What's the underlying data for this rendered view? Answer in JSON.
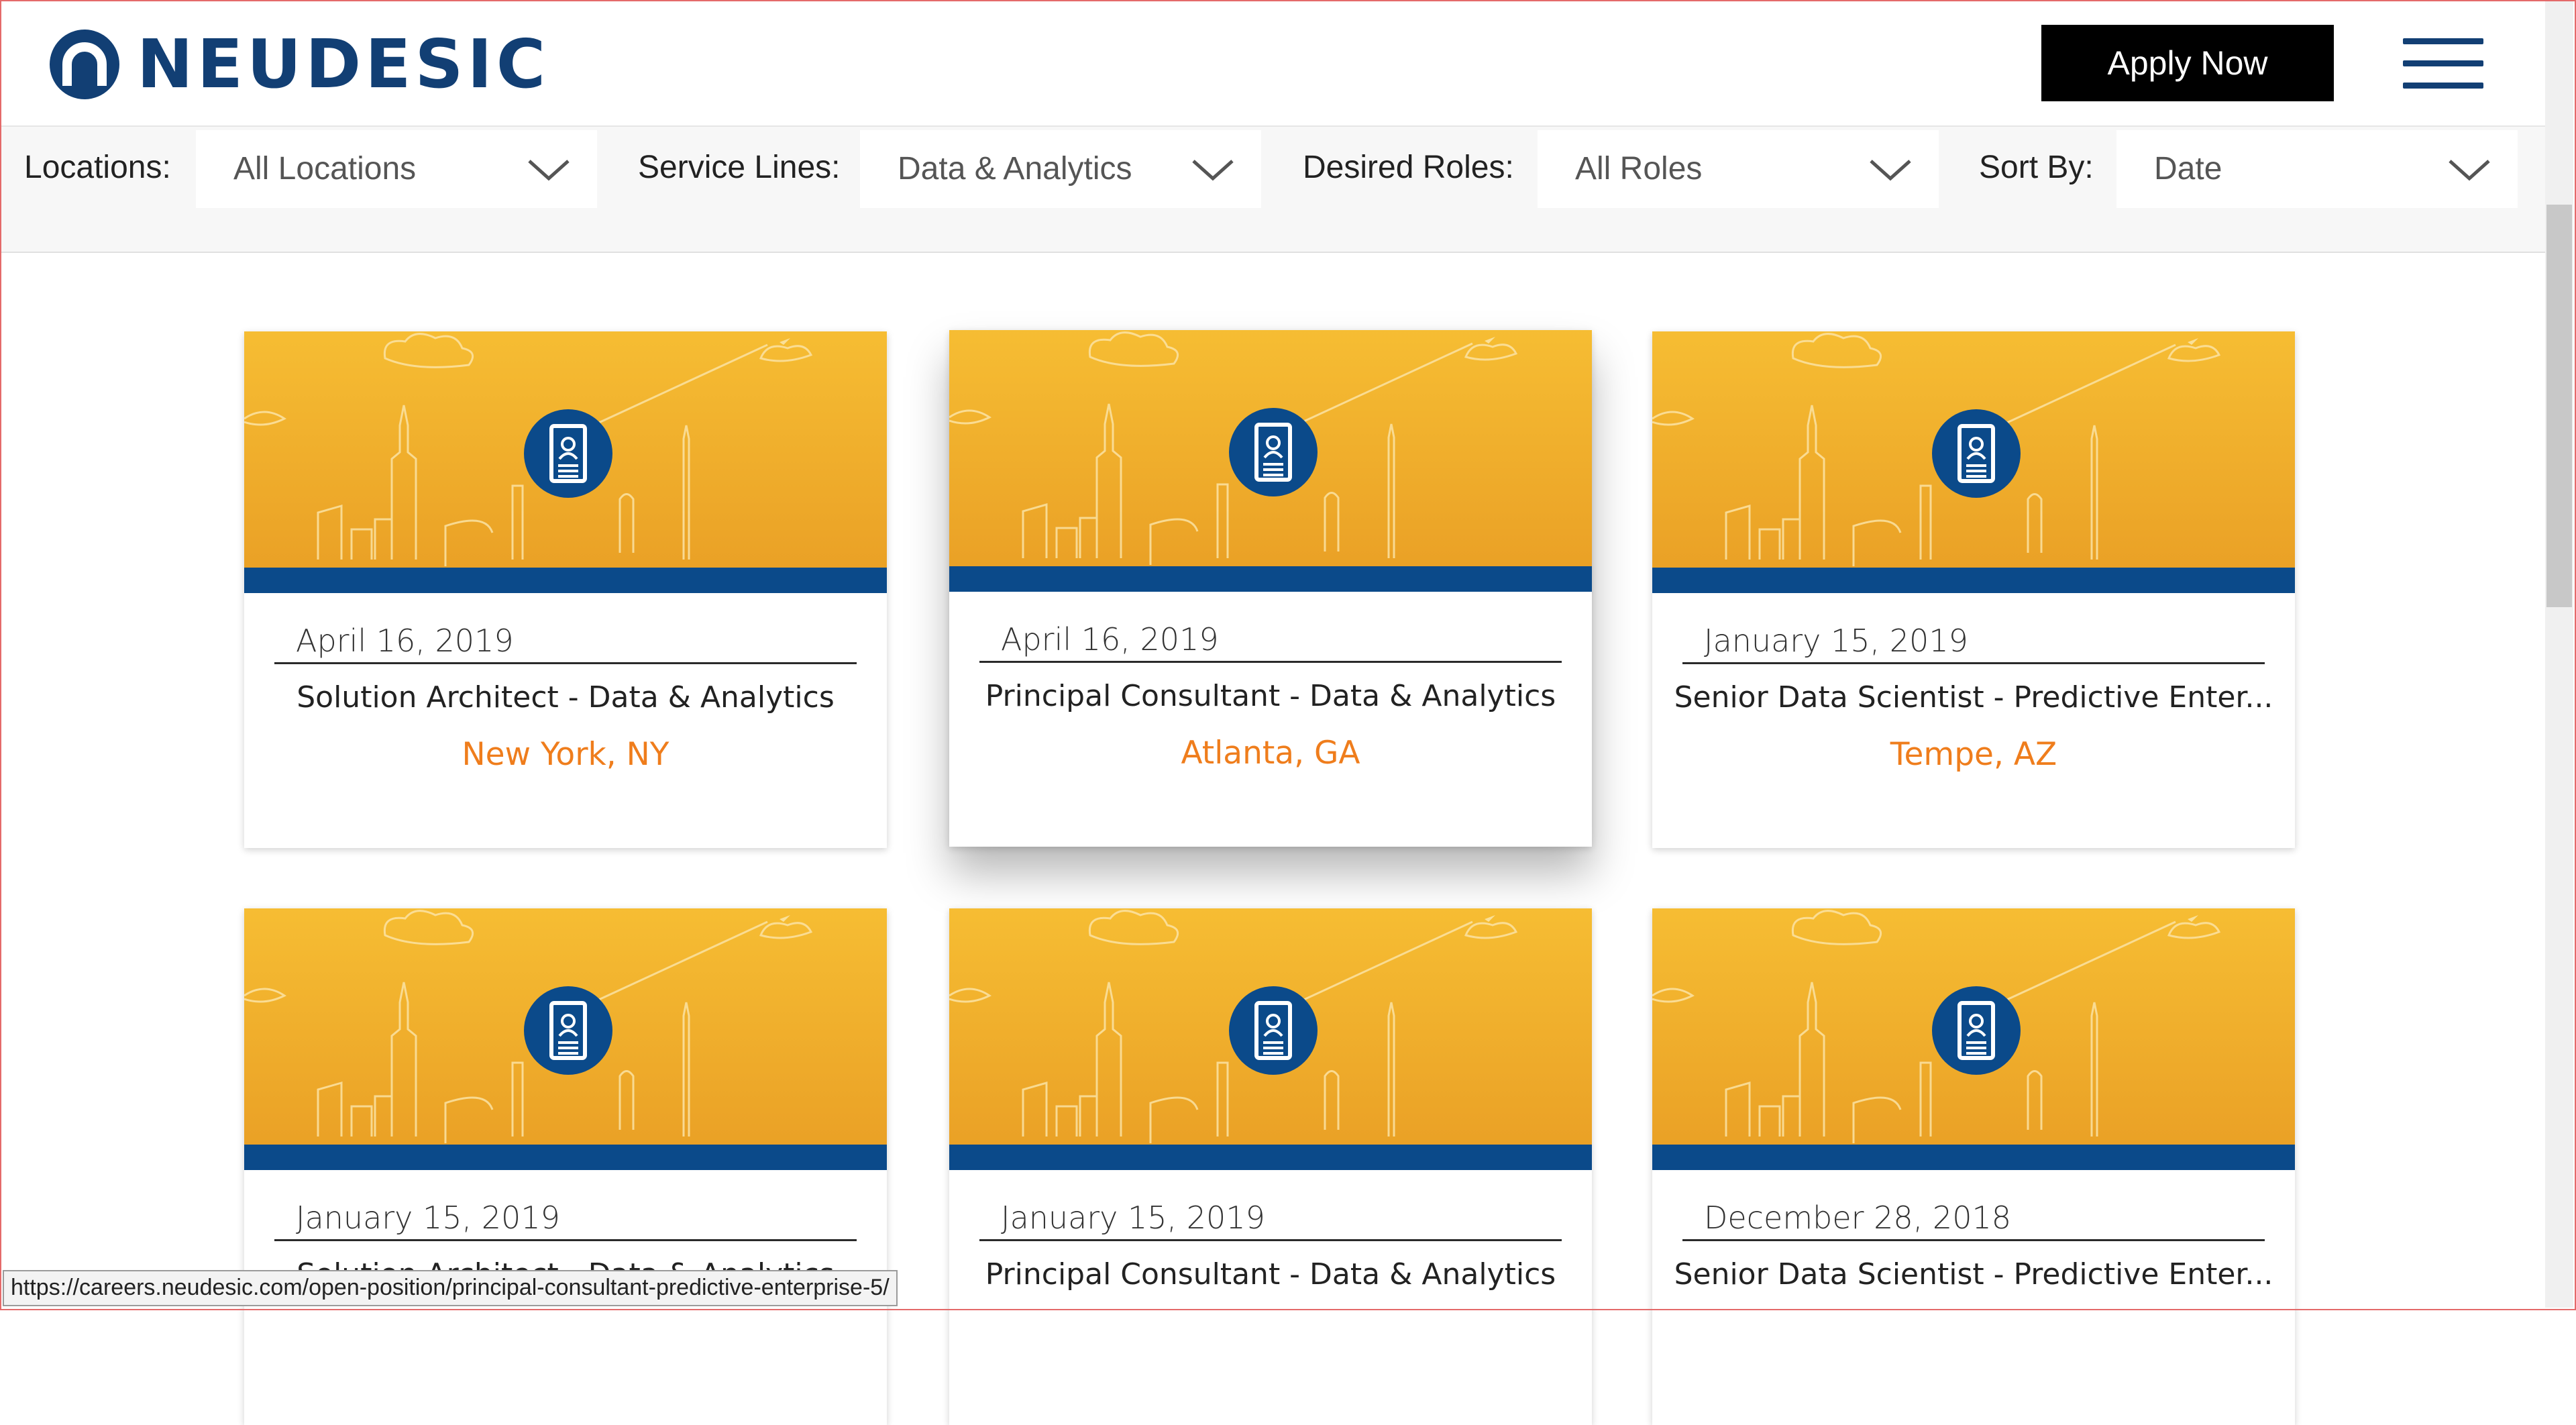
{
  "header": {
    "logo_text": "NEUDESIC",
    "apply_label": "Apply Now"
  },
  "filters": {
    "locations": {
      "label": "Locations:",
      "value": "All Locations"
    },
    "service_lines": {
      "label": "Service Lines:",
      "value": "Data & Analytics"
    },
    "desired_roles": {
      "label": "Desired Roles:",
      "value": "All Roles"
    },
    "sort_by": {
      "label": "Sort By:",
      "value": "Date"
    }
  },
  "jobs": [
    {
      "date": "April 16, 2019",
      "title": "Solution Architect - Data & Analytics",
      "location": "New York, NY"
    },
    {
      "date": "April 16, 2019",
      "title": "Principal Consultant - Data & Analytics",
      "location": "Atlanta, GA"
    },
    {
      "date": "January 15, 2019",
      "title": "Senior Data Scientist - Predictive Enter...",
      "location": "Tempe, AZ"
    },
    {
      "date": "January 15, 2019",
      "title": "Solution Architect - Data & Analytics",
      "location": ""
    },
    {
      "date": "January 15, 2019",
      "title": "Principal Consultant - Data & Analytics",
      "location": ""
    },
    {
      "date": "December 28, 2018",
      "title": "Senior Data Scientist - Predictive Enter...",
      "location": ""
    }
  ],
  "status_url": "https://careers.neudesic.com/open-position/principal-consultant-predictive-enterprise-5/",
  "colors": {
    "brand_navy": "#123f74",
    "banner_yellow_top": "#f6bd33",
    "banner_yellow_bottom": "#eaa126",
    "banner_stripe": "#0b4a8a",
    "location_orange": "#ef7d1c"
  },
  "icons": {
    "menu": "hamburger-menu-icon",
    "dropdown": "chevron-down-icon",
    "job": "resume-badge-icon"
  }
}
